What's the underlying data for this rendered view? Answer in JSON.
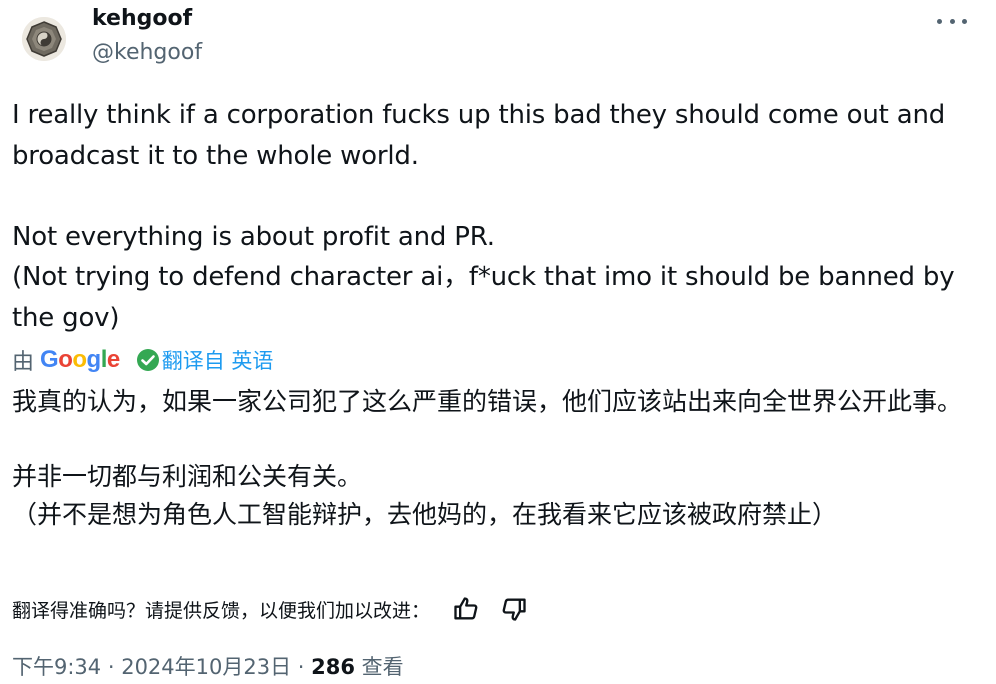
{
  "author": {
    "name": "kehgoof",
    "handle": "@kehgoof",
    "avatar": "bagua-mirror-avatar",
    "more_icon": "more-horizontal-icon"
  },
  "tweet": {
    "text": "I really think if a corporation fucks up this bad they should come out and broadcast it to the whole world.\n\nNot everything is about profit and PR.\n(Not trying to defend character ai，f*uck that imo it should be banned by the gov)"
  },
  "translation": {
    "by_label": "由",
    "provider": "Google",
    "verified_icon": "check-circle-icon",
    "translated_from": "翻译自 英语",
    "text": "我真的认为，如果一家公司犯了这么严重的错误，他们应该站出来向全世界公开此事。\n\n并非一切都与利润和公关有关。\n（并不是想为角色人工智能辩护，去他妈的，在我看来它应该被政府禁止）",
    "feedback_prompt": "翻译得准确吗？请提供反馈，以便我们加以改进：",
    "thumbs_up_icon": "thumbs-up-icon",
    "thumbs_down_icon": "thumbs-down-icon"
  },
  "meta": {
    "time": "下午9:34",
    "separator": " · ",
    "date": "2024年10月23日",
    "views_count": "286",
    "views_label": " 查看"
  },
  "colors": {
    "text": "#0f1419",
    "secondary": "#536471",
    "accent": "#1d9bf0",
    "verified_green": "#34a853"
  }
}
